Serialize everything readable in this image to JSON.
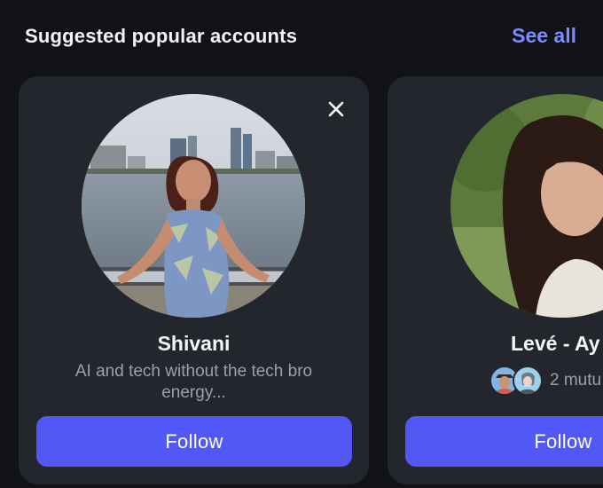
{
  "header": {
    "title": "Suggested popular accounts",
    "see_all_label": "See all"
  },
  "accounts": [
    {
      "name": "Shivani",
      "bio": "AI and tech without the tech bro energy...",
      "follow_label": "Follow"
    },
    {
      "name": "Levé - Ay",
      "mutuals_text": "2 mutu",
      "follow_label": "Follow"
    }
  ],
  "colors": {
    "background": "#101217",
    "card": "#23262d",
    "accent": "#5258f5",
    "link": "#7b8cff",
    "muted_text": "#9ba0aa"
  },
  "icons": {
    "dismiss": "close-icon"
  }
}
